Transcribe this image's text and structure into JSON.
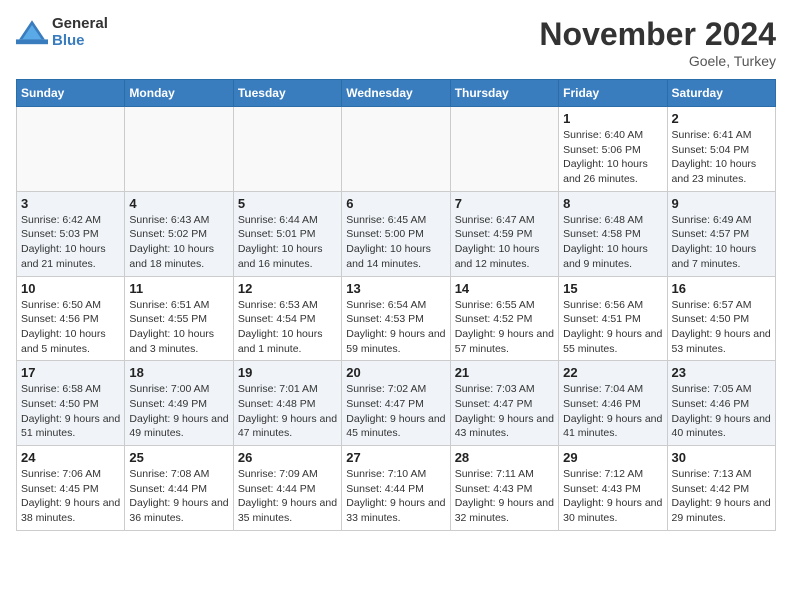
{
  "header": {
    "logo_general": "General",
    "logo_blue": "Blue",
    "month_title": "November 2024",
    "location": "Goele, Turkey"
  },
  "days_of_week": [
    "Sunday",
    "Monday",
    "Tuesday",
    "Wednesday",
    "Thursday",
    "Friday",
    "Saturday"
  ],
  "weeks": [
    [
      {
        "day": "",
        "info": ""
      },
      {
        "day": "",
        "info": ""
      },
      {
        "day": "",
        "info": ""
      },
      {
        "day": "",
        "info": ""
      },
      {
        "day": "",
        "info": ""
      },
      {
        "day": "1",
        "info": "Sunrise: 6:40 AM\nSunset: 5:06 PM\nDaylight: 10 hours and 26 minutes."
      },
      {
        "day": "2",
        "info": "Sunrise: 6:41 AM\nSunset: 5:04 PM\nDaylight: 10 hours and 23 minutes."
      }
    ],
    [
      {
        "day": "3",
        "info": "Sunrise: 6:42 AM\nSunset: 5:03 PM\nDaylight: 10 hours and 21 minutes."
      },
      {
        "day": "4",
        "info": "Sunrise: 6:43 AM\nSunset: 5:02 PM\nDaylight: 10 hours and 18 minutes."
      },
      {
        "day": "5",
        "info": "Sunrise: 6:44 AM\nSunset: 5:01 PM\nDaylight: 10 hours and 16 minutes."
      },
      {
        "day": "6",
        "info": "Sunrise: 6:45 AM\nSunset: 5:00 PM\nDaylight: 10 hours and 14 minutes."
      },
      {
        "day": "7",
        "info": "Sunrise: 6:47 AM\nSunset: 4:59 PM\nDaylight: 10 hours and 12 minutes."
      },
      {
        "day": "8",
        "info": "Sunrise: 6:48 AM\nSunset: 4:58 PM\nDaylight: 10 hours and 9 minutes."
      },
      {
        "day": "9",
        "info": "Sunrise: 6:49 AM\nSunset: 4:57 PM\nDaylight: 10 hours and 7 minutes."
      }
    ],
    [
      {
        "day": "10",
        "info": "Sunrise: 6:50 AM\nSunset: 4:56 PM\nDaylight: 10 hours and 5 minutes."
      },
      {
        "day": "11",
        "info": "Sunrise: 6:51 AM\nSunset: 4:55 PM\nDaylight: 10 hours and 3 minutes."
      },
      {
        "day": "12",
        "info": "Sunrise: 6:53 AM\nSunset: 4:54 PM\nDaylight: 10 hours and 1 minute."
      },
      {
        "day": "13",
        "info": "Sunrise: 6:54 AM\nSunset: 4:53 PM\nDaylight: 9 hours and 59 minutes."
      },
      {
        "day": "14",
        "info": "Sunrise: 6:55 AM\nSunset: 4:52 PM\nDaylight: 9 hours and 57 minutes."
      },
      {
        "day": "15",
        "info": "Sunrise: 6:56 AM\nSunset: 4:51 PM\nDaylight: 9 hours and 55 minutes."
      },
      {
        "day": "16",
        "info": "Sunrise: 6:57 AM\nSunset: 4:50 PM\nDaylight: 9 hours and 53 minutes."
      }
    ],
    [
      {
        "day": "17",
        "info": "Sunrise: 6:58 AM\nSunset: 4:50 PM\nDaylight: 9 hours and 51 minutes."
      },
      {
        "day": "18",
        "info": "Sunrise: 7:00 AM\nSunset: 4:49 PM\nDaylight: 9 hours and 49 minutes."
      },
      {
        "day": "19",
        "info": "Sunrise: 7:01 AM\nSunset: 4:48 PM\nDaylight: 9 hours and 47 minutes."
      },
      {
        "day": "20",
        "info": "Sunrise: 7:02 AM\nSunset: 4:47 PM\nDaylight: 9 hours and 45 minutes."
      },
      {
        "day": "21",
        "info": "Sunrise: 7:03 AM\nSunset: 4:47 PM\nDaylight: 9 hours and 43 minutes."
      },
      {
        "day": "22",
        "info": "Sunrise: 7:04 AM\nSunset: 4:46 PM\nDaylight: 9 hours and 41 minutes."
      },
      {
        "day": "23",
        "info": "Sunrise: 7:05 AM\nSunset: 4:46 PM\nDaylight: 9 hours and 40 minutes."
      }
    ],
    [
      {
        "day": "24",
        "info": "Sunrise: 7:06 AM\nSunset: 4:45 PM\nDaylight: 9 hours and 38 minutes."
      },
      {
        "day": "25",
        "info": "Sunrise: 7:08 AM\nSunset: 4:44 PM\nDaylight: 9 hours and 36 minutes."
      },
      {
        "day": "26",
        "info": "Sunrise: 7:09 AM\nSunset: 4:44 PM\nDaylight: 9 hours and 35 minutes."
      },
      {
        "day": "27",
        "info": "Sunrise: 7:10 AM\nSunset: 4:44 PM\nDaylight: 9 hours and 33 minutes."
      },
      {
        "day": "28",
        "info": "Sunrise: 7:11 AM\nSunset: 4:43 PM\nDaylight: 9 hours and 32 minutes."
      },
      {
        "day": "29",
        "info": "Sunrise: 7:12 AM\nSunset: 4:43 PM\nDaylight: 9 hours and 30 minutes."
      },
      {
        "day": "30",
        "info": "Sunrise: 7:13 AM\nSunset: 4:42 PM\nDaylight: 9 hours and 29 minutes."
      }
    ]
  ]
}
